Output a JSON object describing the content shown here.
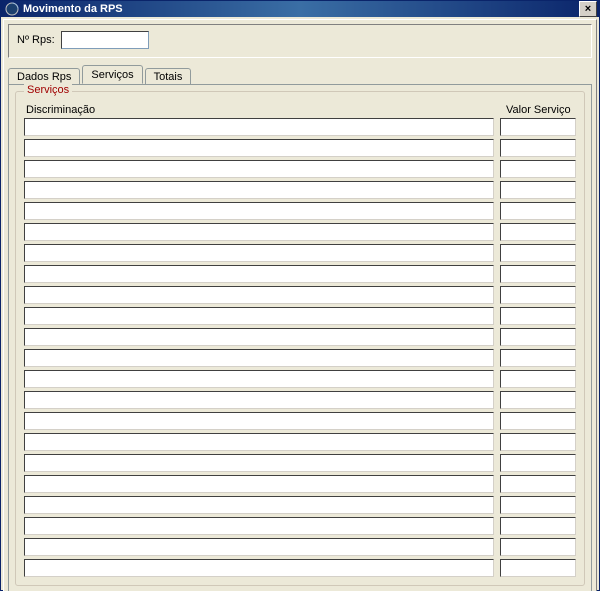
{
  "window": {
    "title": "Movimento da RPS",
    "close_glyph": "×"
  },
  "form": {
    "rps_label": "Nº Rps:",
    "rps_value": ""
  },
  "tabs": [
    {
      "label": "Dados Rps",
      "active": false
    },
    {
      "label": "Serviços",
      "active": true
    },
    {
      "label": "Totais",
      "active": false
    }
  ],
  "servicos_group": {
    "legend": "Serviços",
    "col_discriminacao": "Discriminação",
    "col_valor": "Valor Serviço",
    "rows": [
      {
        "discriminacao": "",
        "valor": ""
      },
      {
        "discriminacao": "",
        "valor": ""
      },
      {
        "discriminacao": "",
        "valor": ""
      },
      {
        "discriminacao": "",
        "valor": ""
      },
      {
        "discriminacao": "",
        "valor": ""
      },
      {
        "discriminacao": "",
        "valor": ""
      },
      {
        "discriminacao": "",
        "valor": ""
      },
      {
        "discriminacao": "",
        "valor": ""
      },
      {
        "discriminacao": "",
        "valor": ""
      },
      {
        "discriminacao": "",
        "valor": ""
      },
      {
        "discriminacao": "",
        "valor": ""
      },
      {
        "discriminacao": "",
        "valor": ""
      },
      {
        "discriminacao": "",
        "valor": ""
      },
      {
        "discriminacao": "",
        "valor": ""
      },
      {
        "discriminacao": "",
        "valor": ""
      },
      {
        "discriminacao": "",
        "valor": ""
      },
      {
        "discriminacao": "",
        "valor": ""
      },
      {
        "discriminacao": "",
        "valor": ""
      },
      {
        "discriminacao": "",
        "valor": ""
      },
      {
        "discriminacao": "",
        "valor": ""
      },
      {
        "discriminacao": "",
        "valor": ""
      },
      {
        "discriminacao": "",
        "valor": ""
      }
    ]
  }
}
